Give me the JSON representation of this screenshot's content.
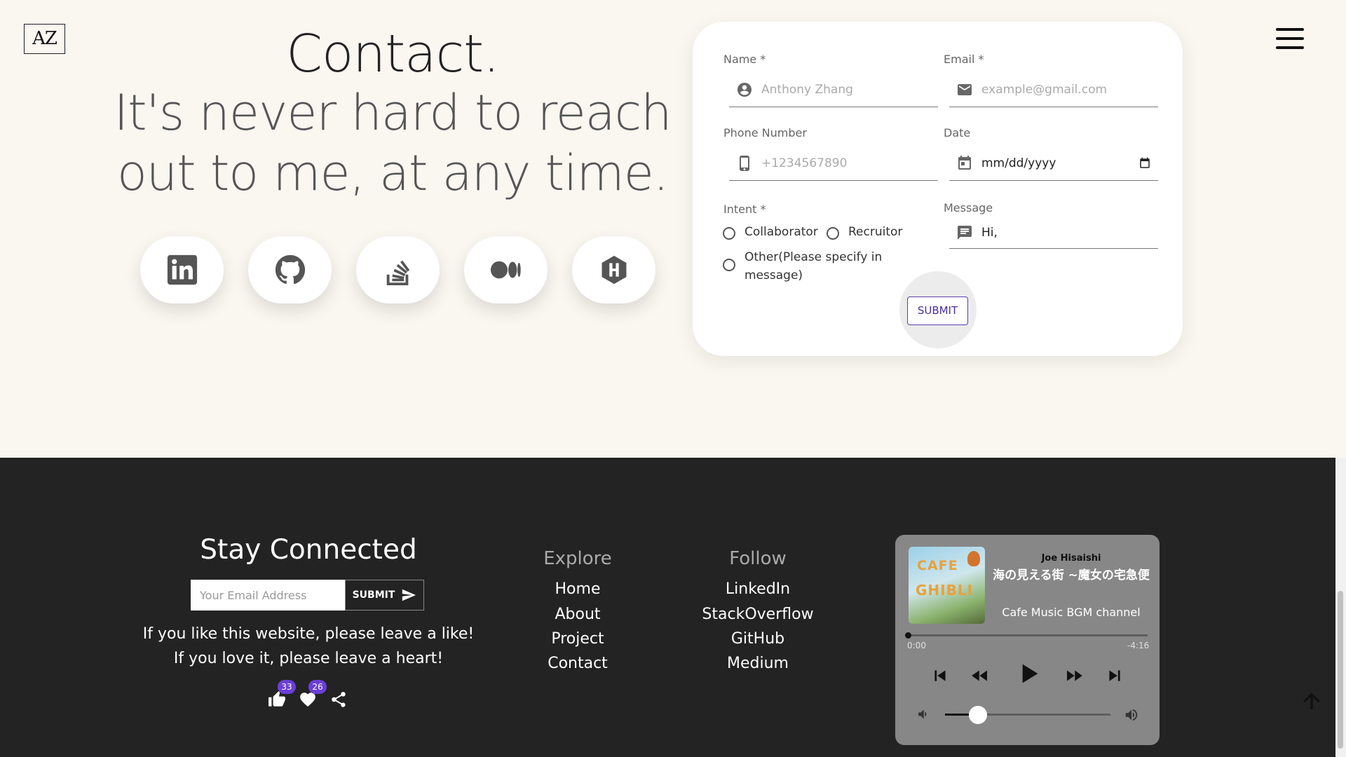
{
  "logo": "AZ",
  "hero": {
    "title": "Contact.",
    "subtitle_line1": "It's never hard to reach",
    "subtitle_line2": "out to me, at any time."
  },
  "social_icons": [
    "linkedin-icon",
    "github-icon",
    "stackoverflow-icon",
    "medium-icon",
    "hashnode-icon"
  ],
  "form": {
    "name_label": "Name *",
    "name_placeholder": "Anthony Zhang",
    "email_label": "Email *",
    "email_placeholder": "example@gmail.com",
    "phone_label": "Phone Number",
    "phone_placeholder": "+1234567890",
    "date_label": "Date",
    "date_placeholder": "mm/dd/yyyy",
    "intent_label": "Intent *",
    "intent_options": [
      "Collaborator",
      "Recruitor",
      "Other(Please specify in",
      "message)"
    ],
    "message_label": "Message",
    "message_value": "Hi,",
    "submit": "SUBMIT",
    "accent_color": "#4a2fa0"
  },
  "footer": {
    "stay_title": "Stay Connected",
    "newsletter_placeholder": "Your Email Address",
    "newsletter_submit": "SUBMIT",
    "line1": "If you like this website, please leave a like!",
    "line2": "If you love it, please leave a heart!",
    "likes": "33",
    "hearts": "26",
    "explore_title": "Explore",
    "explore_links": [
      "Home",
      "About",
      "Project",
      "Contact"
    ],
    "follow_title": "Follow",
    "follow_links": [
      "LinkedIn",
      "StackOverflow",
      "GitHub",
      "Medium"
    ]
  },
  "player": {
    "cover_text1": "CAFE",
    "cover_text2": "GHIBLI",
    "artist": "Joe Hisaishi",
    "track": "海の見える街 ~魔女の宅急便",
    "channel": "Cafe Music BGM channel",
    "elapsed": "0:00",
    "remaining": "-4:16",
    "progress_fraction": 0.0,
    "volume_fraction": 0.2
  }
}
